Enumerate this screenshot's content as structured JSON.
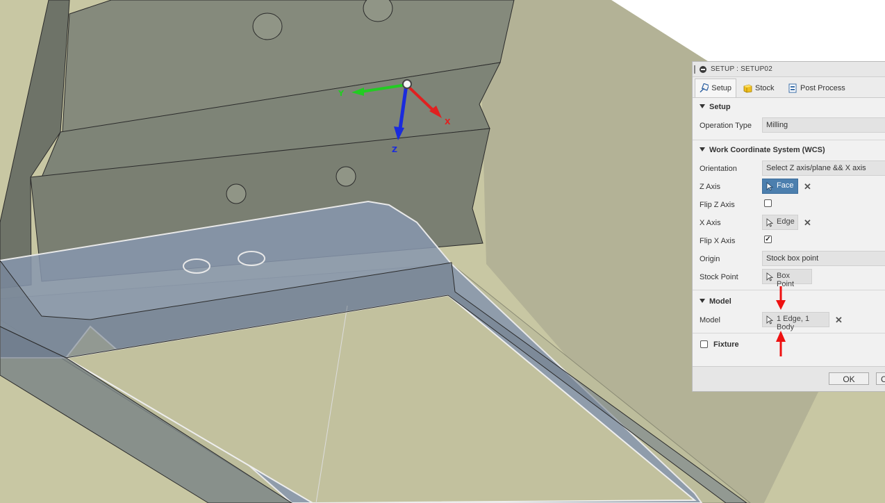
{
  "viewport": {
    "axes": {
      "x_label": "X",
      "y_label": "Y",
      "z_label": "Z"
    },
    "colors": {
      "background_plane": "#c8c7a3",
      "part_gray": "#8a8f80",
      "selection_blue": "#7f92ad",
      "x_axis": "#e02020",
      "y_axis": "#22cc22",
      "z_axis": "#1a2bdd",
      "annotation_arrow": "#ee1111"
    }
  },
  "panel": {
    "title": "SETUP : SETUP02",
    "tabs": [
      {
        "label": "Setup",
        "icon": "setup-icon",
        "active": true
      },
      {
        "label": "Stock",
        "icon": "stock-cube-icon",
        "active": false
      },
      {
        "label": "Post Process",
        "icon": "post-process-icon",
        "active": false
      }
    ],
    "setup_section": {
      "heading": "Setup",
      "operation_type_label": "Operation Type",
      "operation_type_value": "Milling"
    },
    "wcs_section": {
      "heading": "Work Coordinate System (WCS)",
      "orientation_label": "Orientation",
      "orientation_value": "Select Z axis/plane && X axis",
      "z_axis_label": "Z Axis",
      "z_axis_value": "Face",
      "flip_z_label": "Flip Z Axis",
      "flip_z_checked": false,
      "x_axis_label": "X Axis",
      "x_axis_value": "Edge",
      "flip_x_label": "Flip X Axis",
      "flip_x_checked": true,
      "origin_label": "Origin",
      "origin_value": "Stock box point",
      "stock_point_label": "Stock Point",
      "stock_point_value": "Box Point"
    },
    "model_section": {
      "heading": "Model",
      "model_label": "Model",
      "model_value": "1 Edge, 1 Body"
    },
    "fixture_section": {
      "heading": "Fixture",
      "checked": false
    },
    "footer": {
      "ok_label": "OK",
      "cancel_label": "C"
    },
    "clear_glyph": "✕",
    "checkmark_glyph": "✓"
  }
}
